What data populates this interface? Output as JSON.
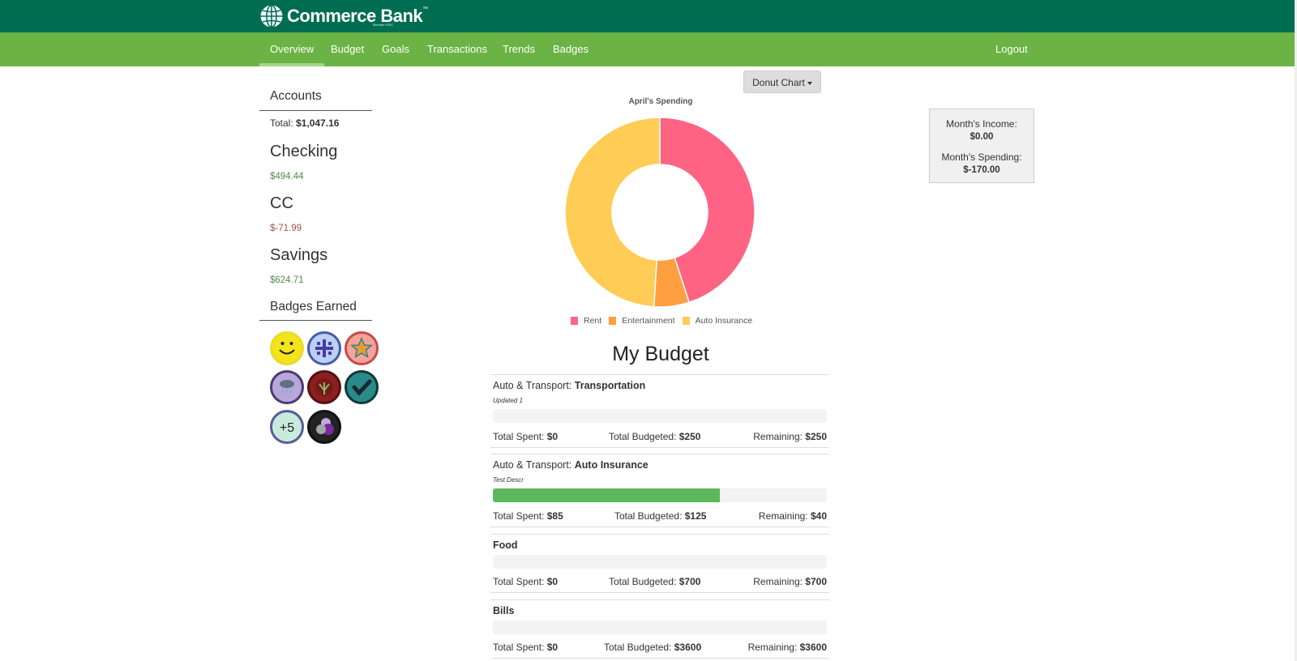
{
  "header": {
    "brand": "Commerce Bank",
    "trademark": "™",
    "fdic": "Member FDIC"
  },
  "nav": {
    "items": [
      "Overview",
      "Budget",
      "Goals",
      "Transactions",
      "Trends",
      "Badges"
    ],
    "active": "Overview",
    "logout": "Logout"
  },
  "accounts": {
    "title": "Accounts",
    "total_label": "Total:",
    "total_value": "$1,047.16",
    "list": [
      {
        "name": "Checking",
        "balance": "$494.44"
      },
      {
        "name": "CC",
        "balance": "$-71.99"
      },
      {
        "name": "Savings",
        "balance": "$624.71"
      }
    ]
  },
  "badges": {
    "title": "Badges Earned",
    "items": [
      "smiley-badge-icon",
      "plus-cross-badge-icon",
      "star-badge-icon",
      "rain-cloud-badge-icon",
      "plant-badge-icon",
      "checkmark-badge-icon",
      "plus-five-badge-icon",
      "circles-badge-icon"
    ],
    "plus_five_text": "+5"
  },
  "chart_toggle": {
    "label": "Donut Chart"
  },
  "chart_data": {
    "type": "pie",
    "style": "donut",
    "title": "April's Spending",
    "categories": [
      "Rent",
      "Entertainment",
      "Auto Insurance"
    ],
    "values": [
      45,
      6,
      49
    ],
    "colors": [
      "#ff6384",
      "#ff9f40",
      "#ffcd56"
    ],
    "legend_position": "bottom"
  },
  "budget": {
    "title": "My Budget",
    "spent_label": "Total Spent:",
    "budgeted_label": "Total Budgeted:",
    "remaining_label": "Remaining:",
    "items": [
      {
        "category": "Auto & Transport:",
        "name": "Transportation",
        "desc": "Updated 1",
        "progress": 0,
        "spent": "$0",
        "budgeted": "$250",
        "remaining": "$250"
      },
      {
        "category": "Auto & Transport:",
        "name": "Auto Insurance",
        "desc": "Test Descr",
        "progress": 0.68,
        "spent": "$85",
        "budgeted": "$125",
        "remaining": "$40"
      },
      {
        "category": "",
        "name": "Food",
        "desc": "",
        "progress": 0,
        "spent": "$0",
        "budgeted": "$700",
        "remaining": "$700"
      },
      {
        "category": "",
        "name": "Bills",
        "desc": "",
        "progress": 0,
        "spent": "$0",
        "budgeted": "$3600",
        "remaining": "$3600"
      }
    ]
  },
  "summary": {
    "income_label": "Month's Income:",
    "income_value": "$0.00",
    "spending_label": "Month's Spending:",
    "spending_value": "$-170.00"
  }
}
